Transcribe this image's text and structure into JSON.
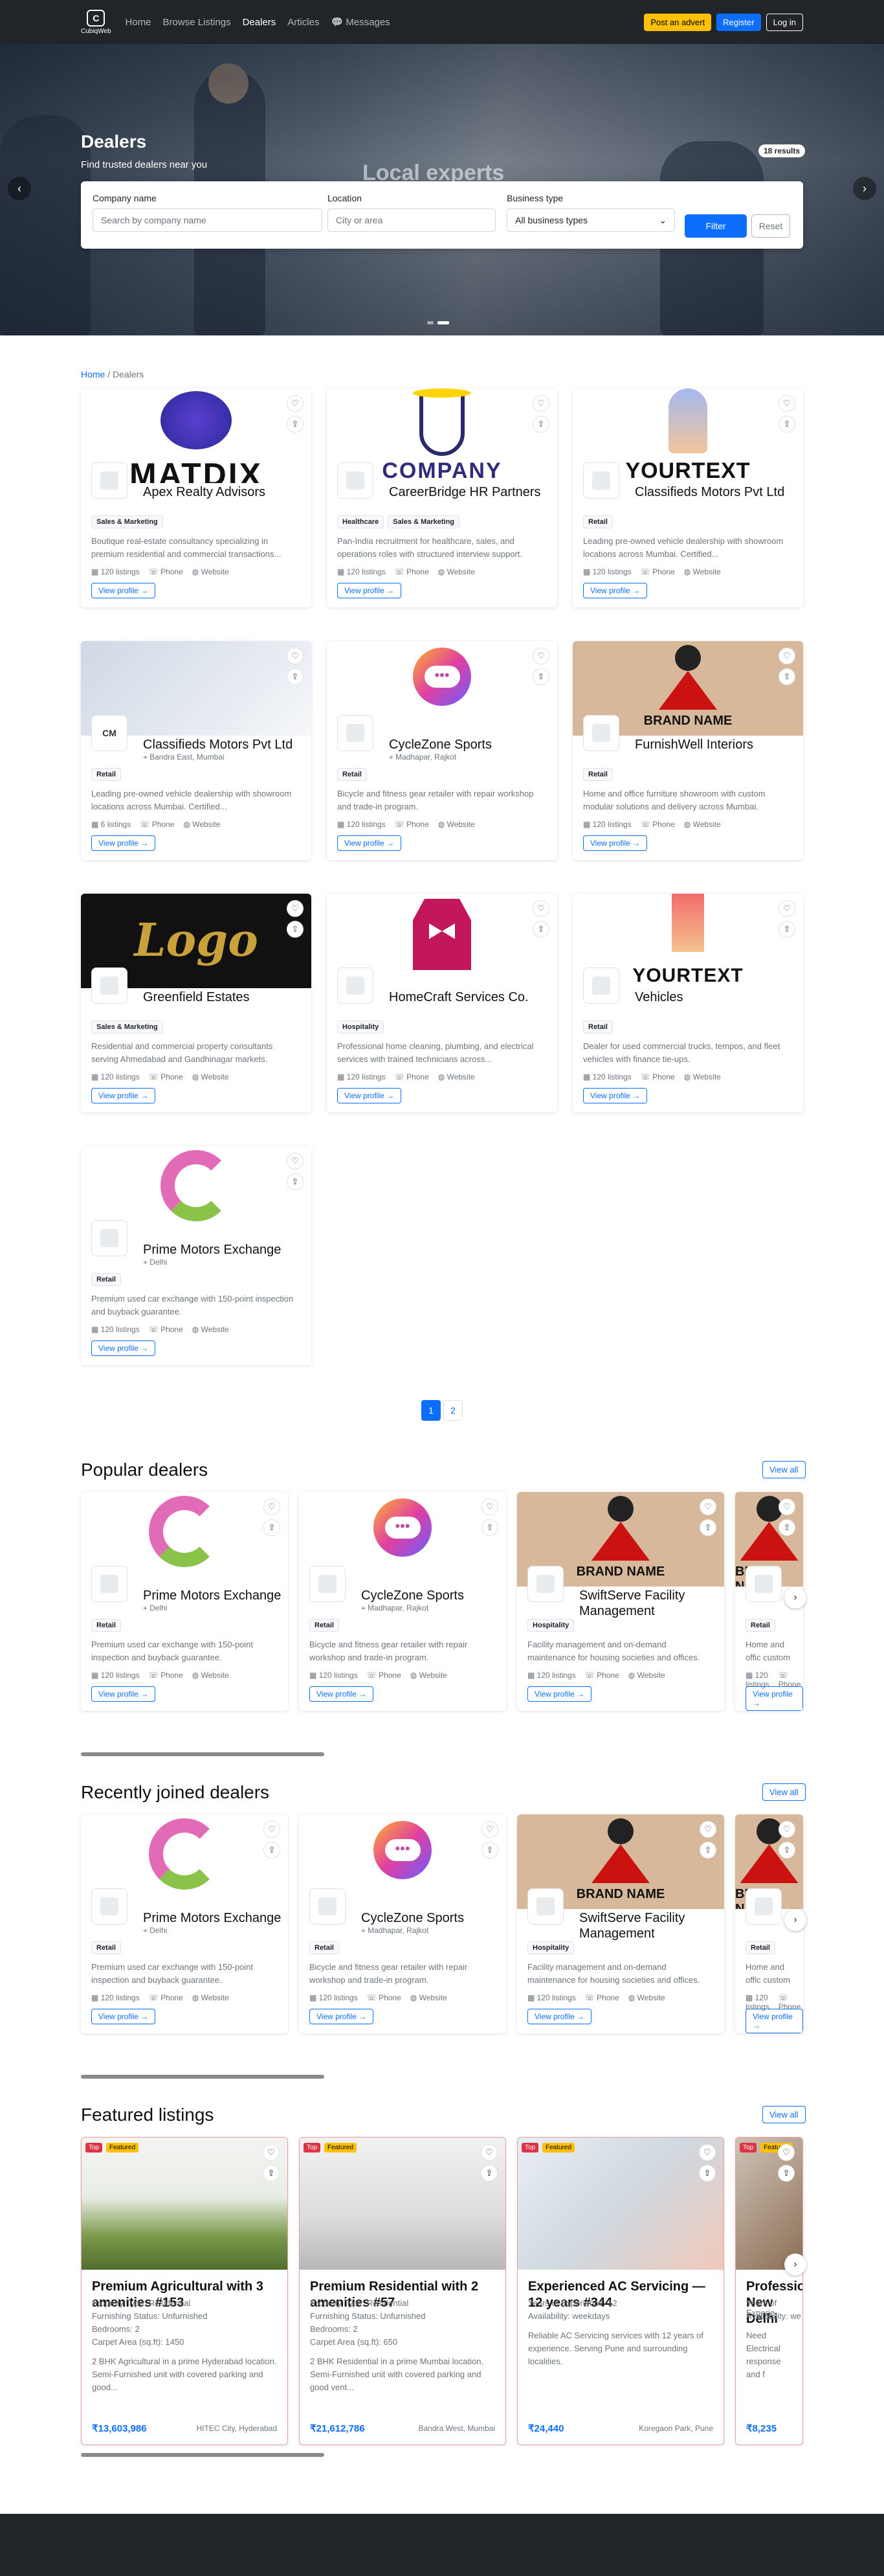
{
  "nav": {
    "brand": "CubiqWeb",
    "brand_mark": "C",
    "links": [
      "Home",
      "Browse Listings",
      "Dealers",
      "Articles",
      "Messages"
    ],
    "post_label": "Post an advert",
    "register_label": "Register",
    "login_label": "Log in"
  },
  "hero": {
    "title": "Dealers",
    "subtitle": "Find trusted dealers near you",
    "caption": "Local experts",
    "results": "18 results"
  },
  "filter": {
    "company_label": "Company name",
    "company_placeholder": "Search by company name",
    "location_label": "Location",
    "location_placeholder": "City or area",
    "type_label": "Business type",
    "type_value": "All business types",
    "filter_label": "Filter",
    "reset_label": "Reset"
  },
  "breadcrumb": {
    "home": "Home",
    "sep": "/",
    "current": "Dealers"
  },
  "meta_labels": {
    "phone": "Phone",
    "website": "Website",
    "view": "View profile →"
  },
  "dealers": [
    {
      "name": "Apex Realty Advisors",
      "logo": "MATDIX",
      "loc": "",
      "tags": [
        "Sales & Marketing"
      ],
      "desc": "Boutique real-estate consultancy specializing in premium residential and commercial transactions...",
      "listings": "120 listings"
    },
    {
      "name": "CareerBridge HR Partners",
      "logo": "COMPANY",
      "loc": "",
      "tags": [
        "Healthcare",
        "Sales & Marketing"
      ],
      "desc": "Pan-India recruitment for healthcare, sales, and operations roles with structured interview support.",
      "listings": "120 listings"
    },
    {
      "name": "Classifieds Motors Pvt Ltd",
      "logo": "YOURTEXT",
      "loc": "",
      "tags": [
        "Retail"
      ],
      "desc": "Leading pre-owned vehicle dealership with showroom locations across Mumbai. Certified...",
      "listings": "120 listings"
    },
    {
      "name": "Classifieds Motors Pvt Ltd",
      "logo": "CM",
      "loc": "Bandra East, Mumbai",
      "tags": [
        "Retail"
      ],
      "desc": "Leading pre-owned vehicle dealership with showroom locations across Mumbai. Certified...",
      "listings": "6 listings"
    },
    {
      "name": "CycleZone Sports",
      "logo": "",
      "loc": "Madhapar, Rajkot",
      "tags": [
        "Retail"
      ],
      "desc": "Bicycle and fitness gear retailer with repair workshop and trade-in program.",
      "listings": "120 listings"
    },
    {
      "name": "FurnishWell Interiors",
      "logo": "BRAND NAME",
      "loc": "",
      "tags": [
        "Retail"
      ],
      "desc": "Home and office furniture showroom with custom modular solutions and delivery across Mumbai.",
      "listings": "120 listings"
    },
    {
      "name": "Greenfield Estates",
      "logo": "Logo",
      "loc": "",
      "tags": [
        "Sales & Marketing"
      ],
      "desc": "Residential and commercial property consultants serving Ahmedabad and Gandhinagar markets.",
      "listings": "120 listings"
    },
    {
      "name": "HomeCraft Services Co.",
      "logo": "",
      "loc": "",
      "tags": [
        "Hospitality"
      ],
      "desc": "Professional home cleaning, plumbing, and electrical services with trained technicians across...",
      "listings": "120 listings"
    },
    {
      "name": "Vehicles",
      "logo": "YOURTEXT",
      "loc": "",
      "tags": [
        "Retail"
      ],
      "desc": "Dealer for used commercial trucks, tempos, and fleet vehicles with finance tie-ups.",
      "listings": "120 listings"
    },
    {
      "name": "Prime Motors Exchange",
      "logo": "",
      "loc": "Delhi",
      "tags": [
        "Retail"
      ],
      "desc": "Premium used car exchange with 150-point inspection and buyback guarantee.",
      "listings": "120 listings"
    }
  ],
  "pagination": [
    "1",
    "2"
  ],
  "popular": {
    "title": "Popular dealers",
    "view_all": "View all"
  },
  "recent": {
    "title": "Recently joined dealers",
    "view_all": "View all"
  },
  "carousel_dealers": [
    {
      "name": "Prime Motors Exchange",
      "loc": "Delhi",
      "tags": [
        "Retail"
      ],
      "desc": "Premium used car exchange with 150-point inspection and buyback guarantee.",
      "listings": "120 listings"
    },
    {
      "name": "CycleZone Sports",
      "loc": "Madhapar, Rajkot",
      "tags": [
        "Retail"
      ],
      "desc": "Bicycle and fitness gear retailer with repair workshop and trade-in program.",
      "listings": "120 listings"
    },
    {
      "name": "SwiftServe Facility Management",
      "loc": "",
      "tags": [
        "Hospitality"
      ],
      "desc": "Facility management and on-demand maintenance for housing societies and offices.",
      "listings": "120 listings"
    },
    {
      "name": "",
      "loc": "",
      "tags": [
        "Retail"
      ],
      "desc": "Home and offic custom modula",
      "listings": "120 listings"
    }
  ],
  "featured": {
    "title": "Featured listings",
    "view_all": "View all"
  },
  "badges": {
    "top": "Top",
    "featured": "Featured"
  },
  "listings": [
    {
      "title": "Premium Agricultural with 3 amenities #153",
      "specs": [
        "Property Type: Residential",
        "Furnishing Status: Unfurnished",
        "Bedrooms: 2",
        "Carpet Area (sq.ft): 1450"
      ],
      "desc": "2 BHK Agricultural in a prime Hyderabad location. Semi-Furnished unit with covered parking and good...",
      "price": "₹13,603,986",
      "place": "HITEC City, Hyderabad"
    },
    {
      "title": "Premium Residential with 2 amenities #57",
      "specs": [
        "Property Type: Residential",
        "Furnishing Status: Unfurnished",
        "Bedrooms: 2",
        "Carpet Area (sq.ft): 650"
      ],
      "desc": "2 BHK Residential in a prime Mumbai location. Semi-Furnished unit with covered parking and good vent...",
      "price": "₹21,612,786",
      "place": "Bandra West, Mumbai"
    },
    {
      "title": "Experienced AC Servicing — 12 years #344",
      "specs": [
        "Years of Experience: 12",
        "Availability: weekdays"
      ],
      "desc": "Reliable AC Servicing services with 12 years of experience. Serving Pune and surrounding localities.",
      "price": "₹24,440",
      "place": "Koregaon Park, Pune"
    },
    {
      "title": "Profession New Delhi",
      "specs": [
        "Years of Experie",
        "Availability: we"
      ],
      "desc": "Need Electrical response and f",
      "price": "₹8,235",
      "place": ""
    }
  ]
}
